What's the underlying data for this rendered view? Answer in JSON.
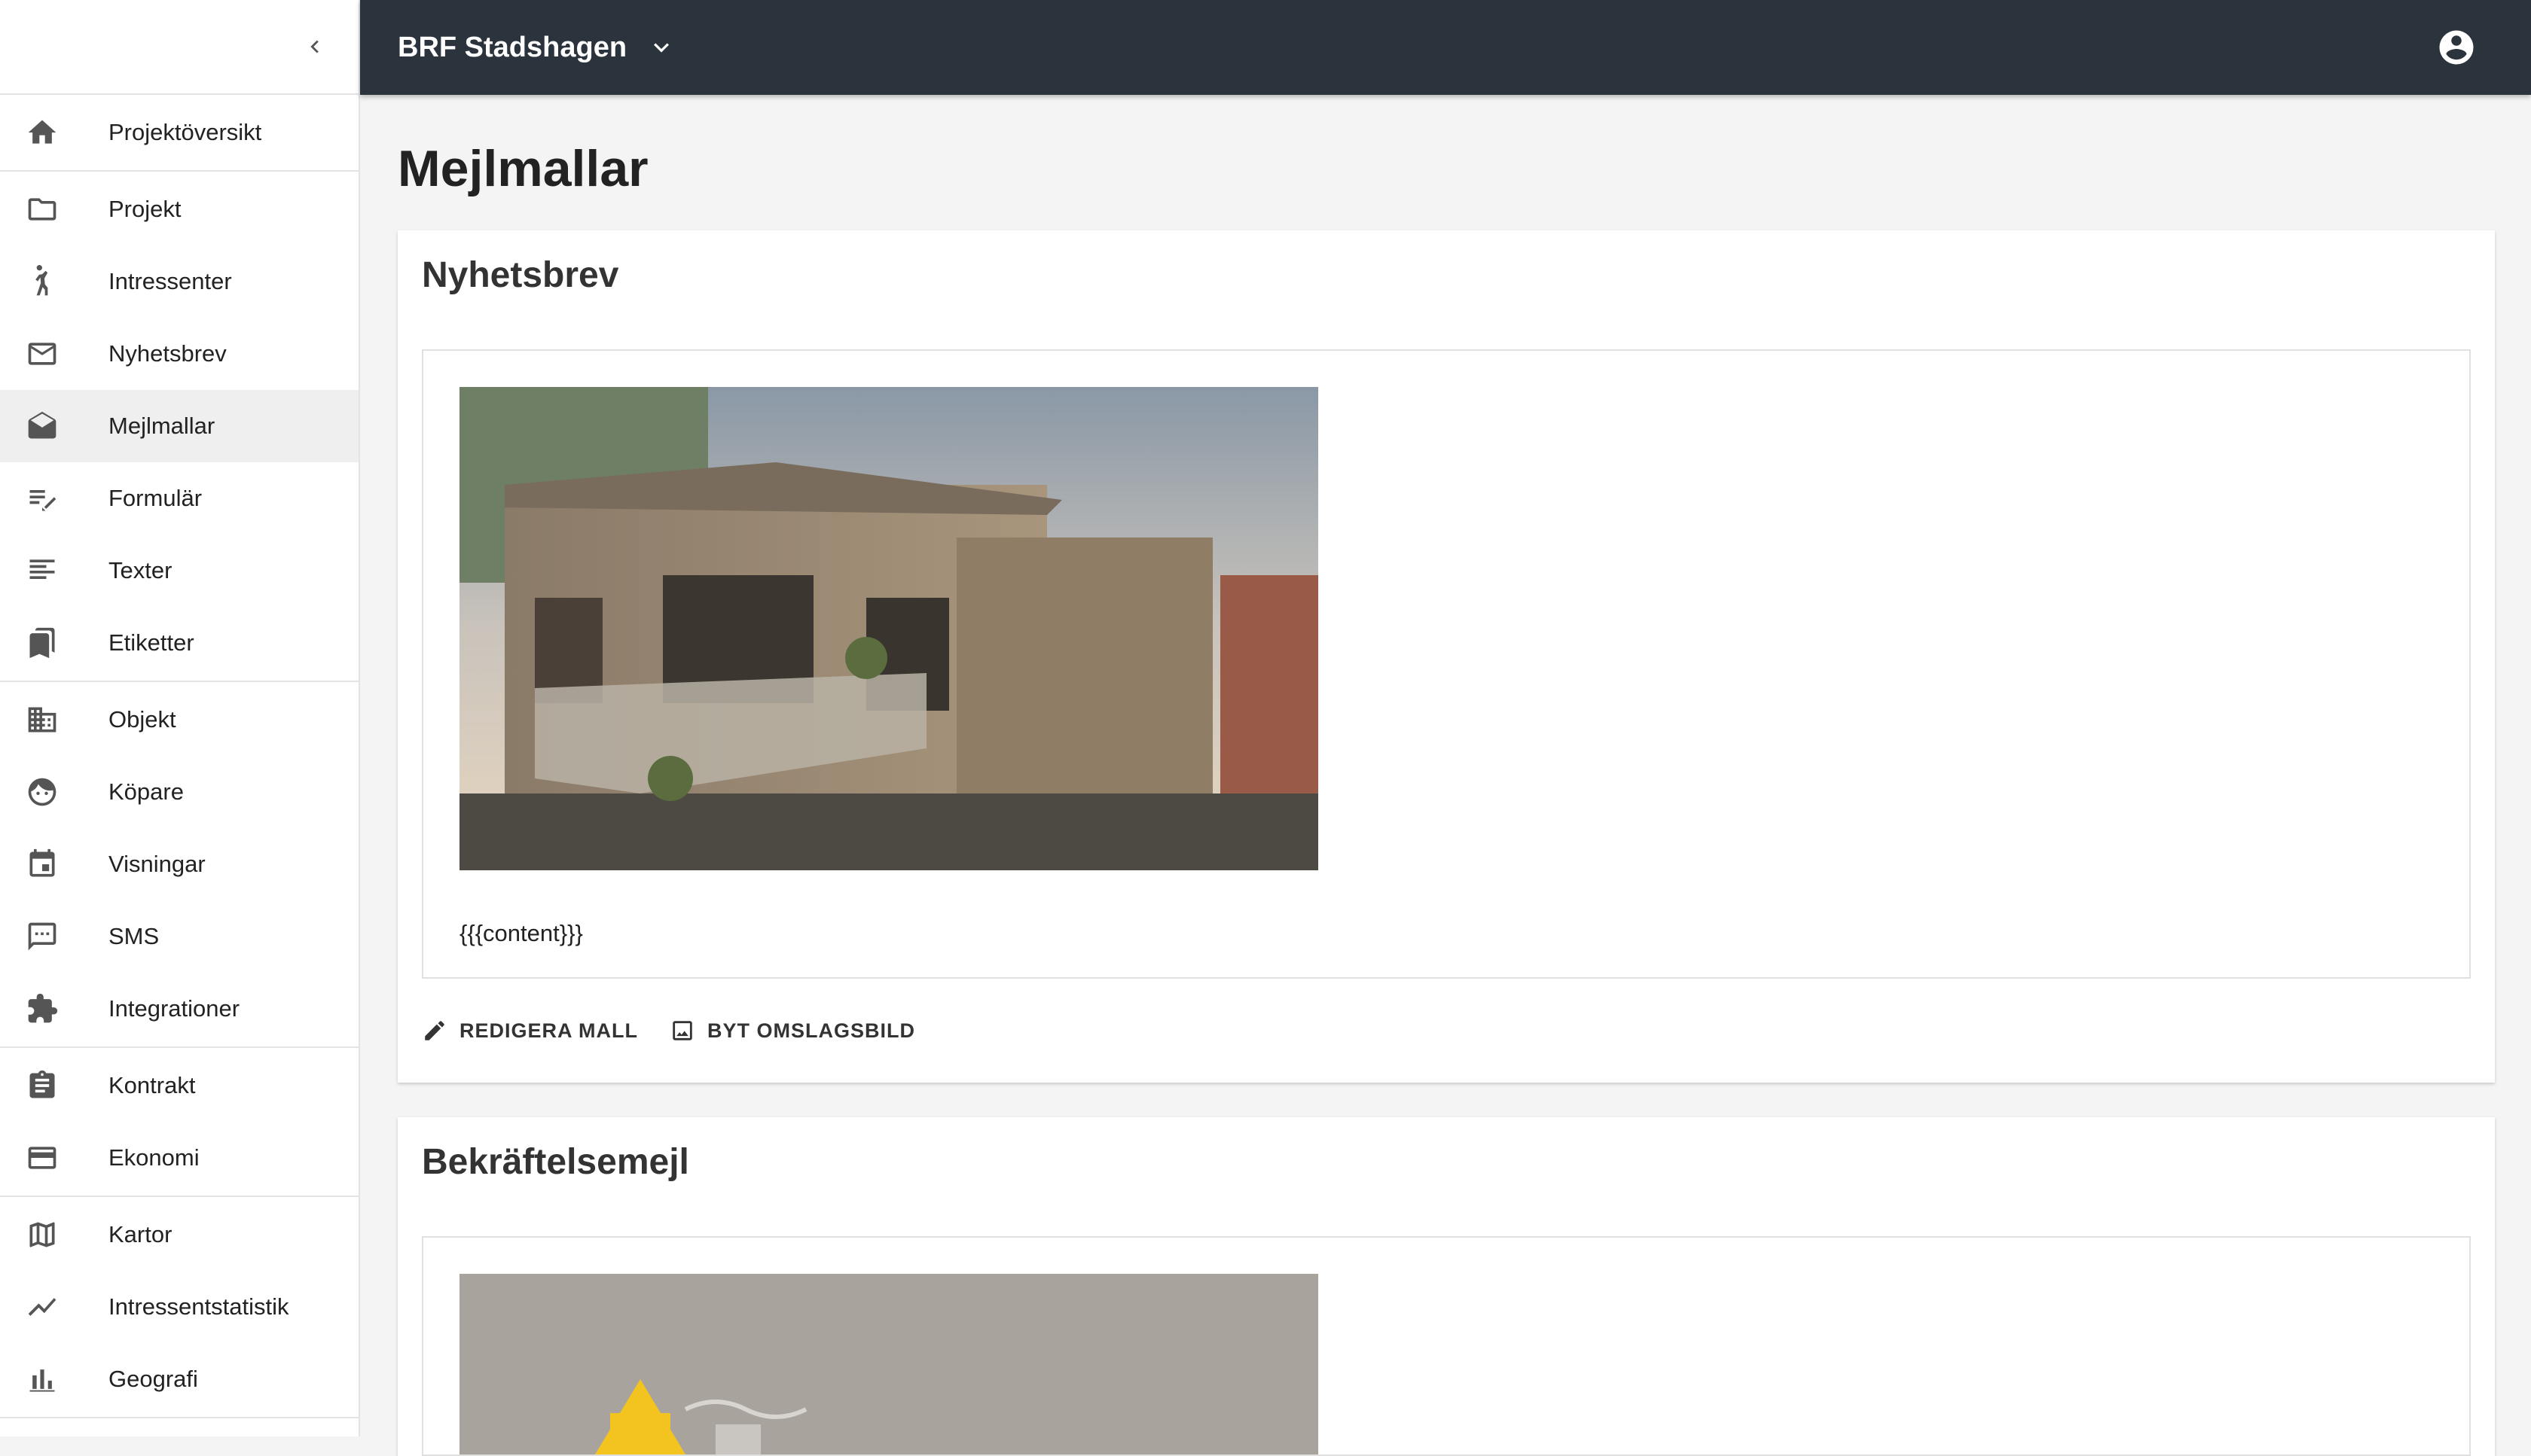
{
  "topbar": {
    "project_name": "BRF Stadshagen"
  },
  "sidebar": {
    "groups": [
      [
        {
          "label": "Projektöversikt",
          "icon": "home-icon"
        }
      ],
      [
        {
          "label": "Projekt",
          "icon": "folder-icon"
        },
        {
          "label": "Intressenter",
          "icon": "person-waving-icon"
        },
        {
          "label": "Nyhetsbrev",
          "icon": "mail-icon"
        },
        {
          "label": "Mejlmallar",
          "icon": "drafts-icon",
          "active": true
        },
        {
          "label": "Formulär",
          "icon": "edit-note-icon"
        },
        {
          "label": "Texter",
          "icon": "text-lines-icon"
        },
        {
          "label": "Etiketter",
          "icon": "bookmarks-icon"
        }
      ],
      [
        {
          "label": "Objekt",
          "icon": "building-icon"
        },
        {
          "label": "Köpare",
          "icon": "face-icon"
        },
        {
          "label": "Visningar",
          "icon": "calendar-icon"
        },
        {
          "label": "SMS",
          "icon": "sms-icon"
        },
        {
          "label": "Integrationer",
          "icon": "puzzle-icon"
        }
      ],
      [
        {
          "label": "Kontrakt",
          "icon": "clipboard-icon"
        },
        {
          "label": "Ekonomi",
          "icon": "credit-card-icon"
        }
      ],
      [
        {
          "label": "Kartor",
          "icon": "map-icon"
        },
        {
          "label": "Intressentstatistik",
          "icon": "trending-icon"
        },
        {
          "label": "Geografi",
          "icon": "bar-chart-icon"
        }
      ]
    ]
  },
  "main": {
    "page_title": "Mejlmallar",
    "cards": [
      {
        "title": "Nyhetsbrev",
        "content_placeholder": "{{{content}}}",
        "edit_label": "REDIGERA MALL",
        "cover_label": "BYT OMSLAGSBILD"
      },
      {
        "title": "Bekräftelsemejl"
      }
    ]
  },
  "colors": {
    "topbar_bg": "#2b333c",
    "page_bg": "#f4f4f4",
    "active_item_bg": "#efefef"
  }
}
